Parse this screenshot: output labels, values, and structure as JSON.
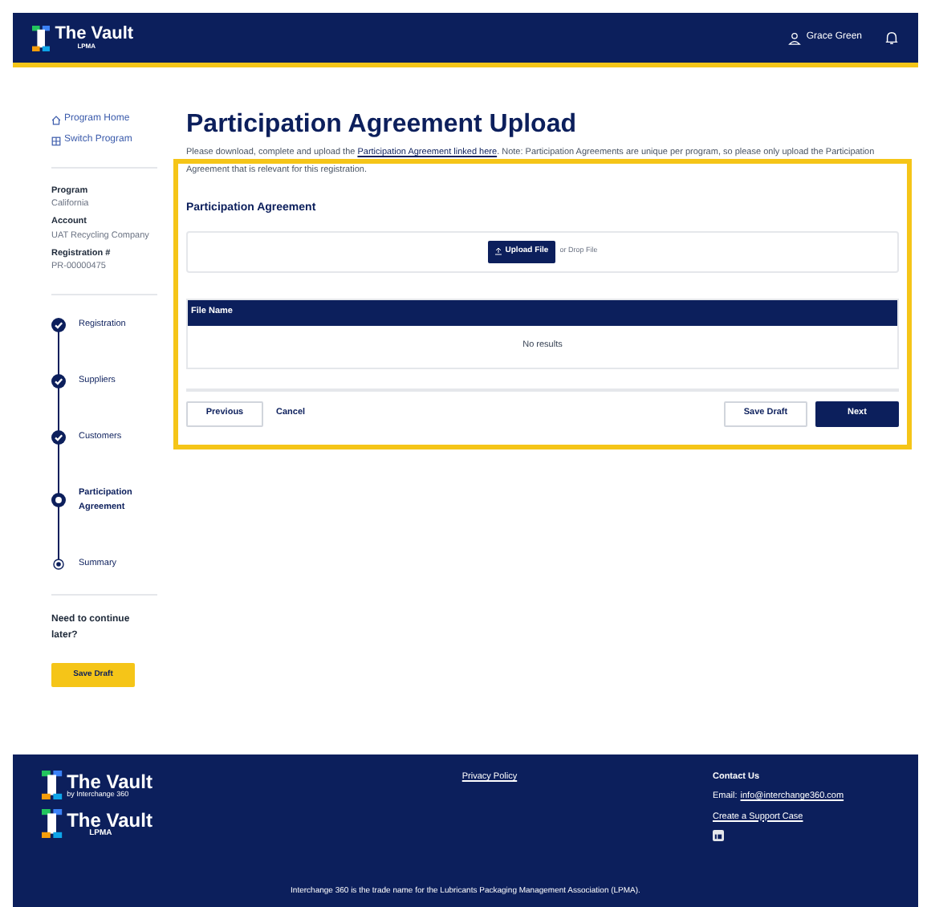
{
  "header": {
    "brand": "The Vault",
    "brand_sub": "LPMA",
    "user": "Grace Green"
  },
  "sidebar": {
    "links": [
      {
        "kind": "home",
        "label": "Program Home"
      },
      {
        "kind": "switch",
        "label": "Switch Program"
      }
    ],
    "details": [
      {
        "label": "Program",
        "value": "California"
      },
      {
        "label": "Account",
        "value": "UAT Recycling Company"
      },
      {
        "label": "Registration #",
        "value": "PR-00000475"
      }
    ],
    "steps": [
      {
        "label": "Registration",
        "kind": "done"
      },
      {
        "label": "Suppliers",
        "kind": "done"
      },
      {
        "label": "Customers",
        "kind": "done"
      },
      {
        "label": "Participation Agreement",
        "kind": "current"
      },
      {
        "label": "Summary",
        "kind": "upcoming"
      }
    ],
    "continue_text": "Need to continue later?",
    "save_draft": "Save Draft"
  },
  "main": {
    "title": "Participation Agreement Upload",
    "intro": [
      {
        "kind": "text",
        "text": "Please download, complete and upload the "
      },
      {
        "kind": "link",
        "text": "Participation Agreement linked here"
      },
      {
        "kind": "text",
        "text": ". Note: Participation Agreements are unique per program, so please only upload the Participation Agreement that is relevant for this registration."
      }
    ],
    "section": "Participation Agreement",
    "upload_button": "Upload File",
    "drop_text": "or Drop File",
    "table": {
      "columns": [
        "File Name"
      ],
      "empty": "No results"
    },
    "buttons": {
      "previous": "Previous",
      "cancel": "Cancel",
      "save_draft": "Save Draft",
      "next": "Next"
    }
  },
  "footer": {
    "brand": "The Vault",
    "brand_sub": "by Interchange 360",
    "brand2": "The Vault",
    "brand2_sub": "LPMA",
    "privacy": "Privacy Policy",
    "contact_title": "Contact Us",
    "email_label": "Email:",
    "email": "info@interchange360.com",
    "support": "Create a Support Case",
    "legal": "Interchange 360 is the trade name for the Lubricants Packaging Management Association (LPMA)."
  }
}
